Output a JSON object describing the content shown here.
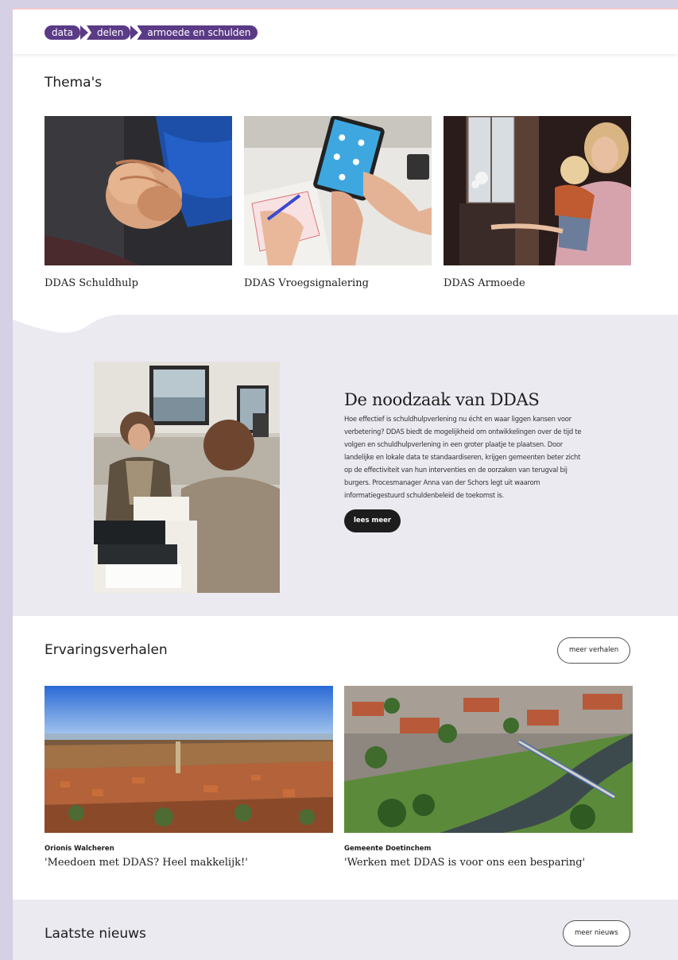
{
  "header": {
    "logo_parts": [
      "data",
      "delen",
      "armoede en schulden"
    ]
  },
  "themes": {
    "title": "Thema's",
    "items": [
      {
        "label": "DDAS Schuldhulp"
      },
      {
        "label": "DDAS Vroegsignalering"
      },
      {
        "label": "DDAS Armoede"
      }
    ]
  },
  "feature": {
    "title": "De noodzaak van DDAS",
    "body": "Hoe effectief is schuldhulpverlening nu écht en waar liggen kansen voor verbetering? DDAS biedt de mogelijkheid om ontwikkelingen over de tijd te volgen en schuldhulpverlening in een groter plaatje te plaatsen. Door landelijke en lokale data te standaardiseren, krijgen gemeenten beter zicht op de effectiviteit van hun interventies en de oorzaken van terugval bij burgers. Procesmanager Anna van der Schors legt uit waarom informatiegestuurd schuldenbeleid de toekomst is.",
    "button": "lees meer"
  },
  "stories": {
    "title": "Ervaringsverhalen",
    "more_button": "meer verhalen",
    "items": [
      {
        "org": "Orionis Walcheren",
        "quote": "'Meedoen met DDAS? Heel makkelijk!'"
      },
      {
        "org": "Gemeente Doetinchem",
        "quote": "'Werken met DDAS is voor ons een besparing'"
      }
    ]
  },
  "news": {
    "title": "Laatste nieuws",
    "more_button": "meer nieuws"
  }
}
